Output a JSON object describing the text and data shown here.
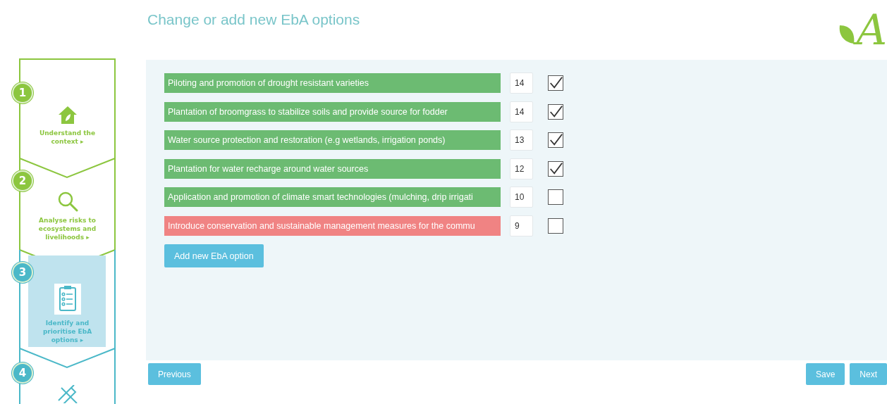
{
  "header": {
    "title": "Change or add new EbA options",
    "logo": "A"
  },
  "steps": [
    {
      "number": "1",
      "kind": "house",
      "label": "Understand the context ▸",
      "color": "#8cc63f",
      "selected": false
    },
    {
      "number": "2",
      "kind": "search",
      "label": "Analyse risks to ecosystems and livelihoods ▸",
      "color": "#8cc63f",
      "selected": false
    },
    {
      "number": "3",
      "kind": "clipboard",
      "label": "Identify and prioritise EbA options ▸",
      "color": "#4bb8c8",
      "selected": true
    },
    {
      "number": "4",
      "kind": "pencil",
      "color": "#4bb8c8",
      "selected": false
    }
  ],
  "options": [
    {
      "label": "Piloting and promotion of drought resistant varieties",
      "score": "14",
      "checked": true,
      "color": "#6cbb72"
    },
    {
      "label": "Plantation of broomgrass to stabilize soils and provide source for fodder",
      "score": "14",
      "checked": true,
      "color": "#6cbb72"
    },
    {
      "label": "Water source protection and restoration (e.g wetlands, irrigation ponds)",
      "score": "13",
      "checked": true,
      "color": "#6cbb72"
    },
    {
      "label": "Plantation for water recharge around water sources",
      "score": "12",
      "checked": true,
      "color": "#6cbb72"
    },
    {
      "label": "Application and promotion of climate smart technologies (mulching, drip irrigati",
      "score": "10",
      "checked": false,
      "color": "#6cbb72"
    },
    {
      "label": "Introduce conservation and sustainable management measures for the commu",
      "score": "9",
      "checked": false,
      "color": "#f08383"
    }
  ],
  "add_button": "Add new EbA option",
  "footer": {
    "previous": "Previous",
    "save": "Save",
    "next": "Next"
  }
}
